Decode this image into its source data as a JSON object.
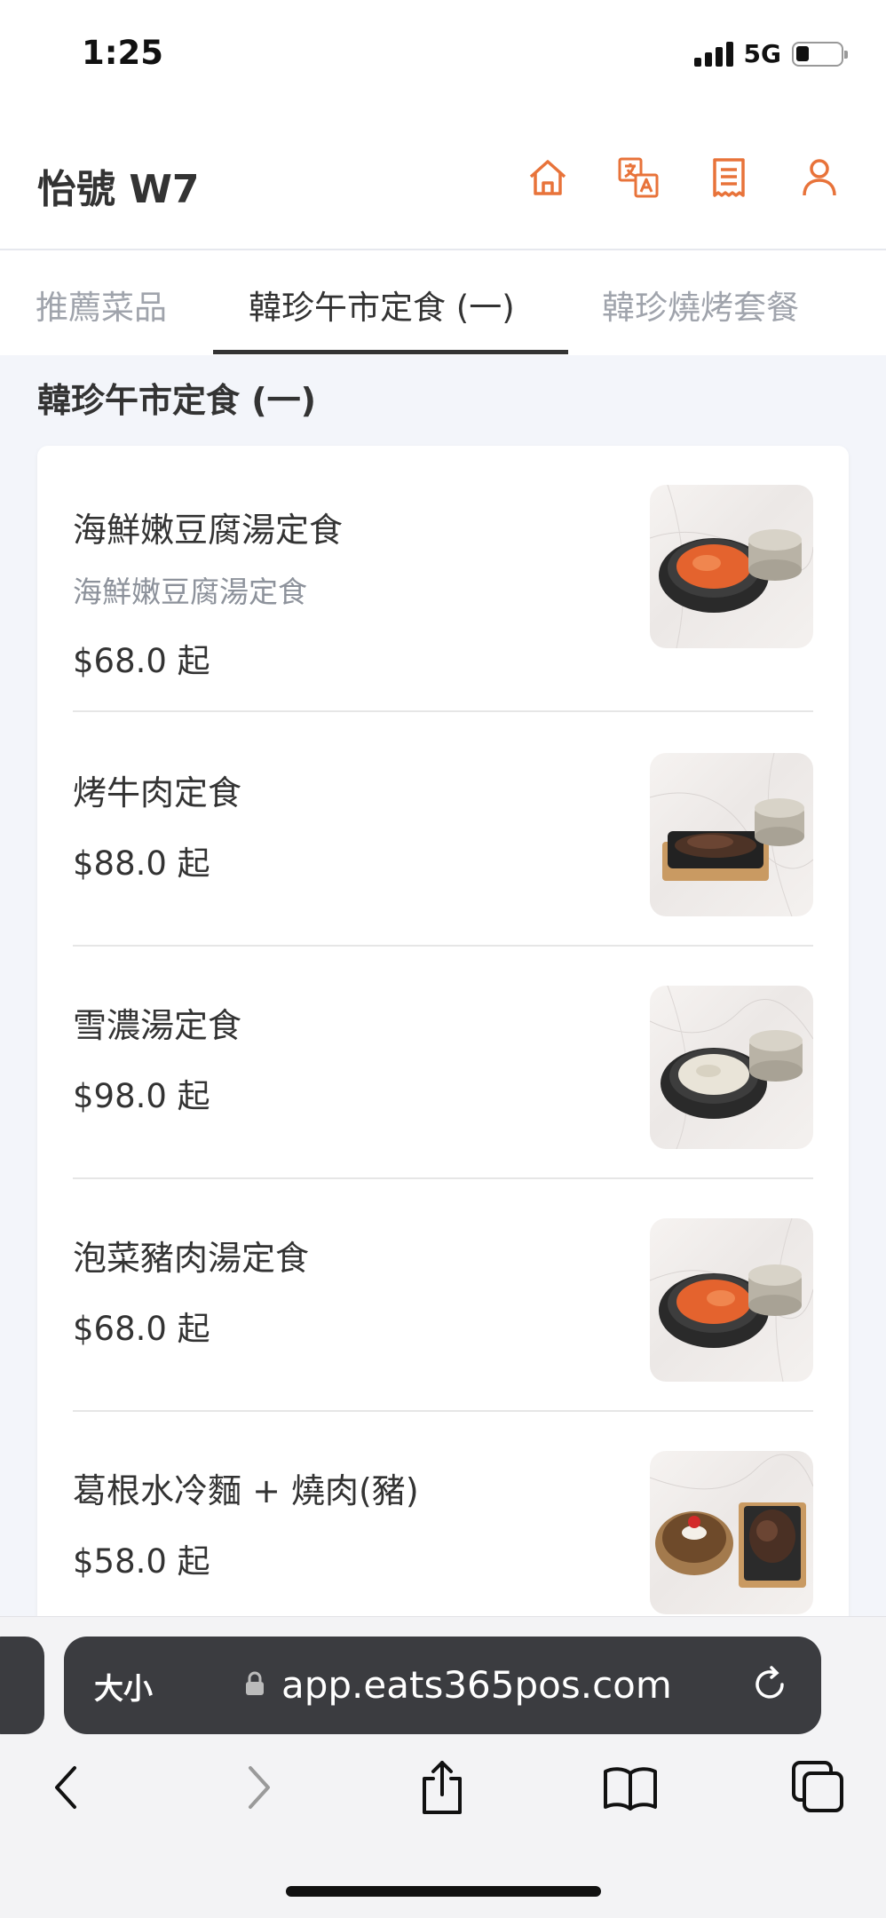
{
  "status_bar": {
    "time": "1:25",
    "network": "5G"
  },
  "header": {
    "shop_name": "怡號 W7",
    "icons": [
      "home-icon",
      "translate-icon",
      "receipt-icon",
      "user-icon"
    ],
    "accent_color": "#e8733a"
  },
  "tabs": [
    {
      "label": "推薦菜品"
    },
    {
      "label": "韓珍午市定食 (一)"
    },
    {
      "label": "韓珍燒烤套餐"
    }
  ],
  "active_tab": "韓珍午市定食 (一)",
  "section": {
    "title": "韓珍午市定食 (一)"
  },
  "menu_items": [
    {
      "name": "海鮮嫩豆腐湯定食",
      "description": "海鮮嫩豆腐湯定食",
      "price": "$68.0 起",
      "image": "spicy-tofu-stew-photo"
    },
    {
      "name": "烤牛肉定食",
      "description": "",
      "price": "$88.0 起",
      "image": "grilled-beef-photo"
    },
    {
      "name": "雪濃湯定食",
      "description": "",
      "price": "$98.0 起",
      "image": "ox-bone-soup-photo"
    },
    {
      "name": "泡菜豬肉湯定食",
      "description": "",
      "price": "$68.0 起",
      "image": "kimchi-pork-stew-photo"
    },
    {
      "name": "葛根水冷麵 + 燒肉(豬)",
      "description": "",
      "price": "$58.0 起",
      "image": "cold-noodle-bbq-pork-photo"
    }
  ],
  "browser": {
    "text_size_label": "大小",
    "url": "app.eats365pos.com"
  }
}
